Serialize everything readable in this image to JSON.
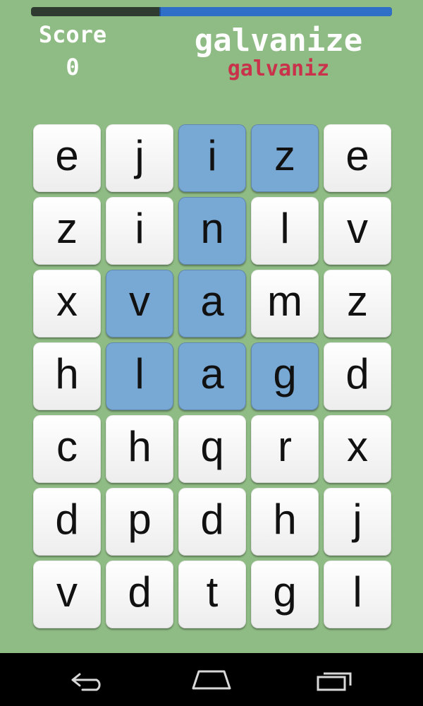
{
  "header": {
    "score_label": "Score",
    "score_value": "0",
    "target_word": "galvanize",
    "current_word": "galvaniz",
    "timer_remaining_fraction": 0.64
  },
  "grid": {
    "rows": [
      [
        {
          "letter": "e",
          "selected": false
        },
        {
          "letter": "j",
          "selected": false
        },
        {
          "letter": "i",
          "selected": true
        },
        {
          "letter": "z",
          "selected": true
        },
        {
          "letter": "e",
          "selected": false
        }
      ],
      [
        {
          "letter": "z",
          "selected": false
        },
        {
          "letter": "i",
          "selected": false
        },
        {
          "letter": "n",
          "selected": true
        },
        {
          "letter": "l",
          "selected": false
        },
        {
          "letter": "v",
          "selected": false
        }
      ],
      [
        {
          "letter": "x",
          "selected": false
        },
        {
          "letter": "v",
          "selected": true
        },
        {
          "letter": "a",
          "selected": true
        },
        {
          "letter": "m",
          "selected": false
        },
        {
          "letter": "z",
          "selected": false
        }
      ],
      [
        {
          "letter": "h",
          "selected": false
        },
        {
          "letter": "l",
          "selected": true
        },
        {
          "letter": "a",
          "selected": true
        },
        {
          "letter": "g",
          "selected": true
        },
        {
          "letter": "d",
          "selected": false
        }
      ],
      [
        {
          "letter": "c",
          "selected": false
        },
        {
          "letter": "h",
          "selected": false
        },
        {
          "letter": "q",
          "selected": false
        },
        {
          "letter": "r",
          "selected": false
        },
        {
          "letter": "x",
          "selected": false
        }
      ],
      [
        {
          "letter": "d",
          "selected": false
        },
        {
          "letter": "p",
          "selected": false
        },
        {
          "letter": "d",
          "selected": false
        },
        {
          "letter": "h",
          "selected": false
        },
        {
          "letter": "j",
          "selected": false
        }
      ],
      [
        {
          "letter": "v",
          "selected": false
        },
        {
          "letter": "d",
          "selected": false
        },
        {
          "letter": "t",
          "selected": false
        },
        {
          "letter": "g",
          "selected": false
        },
        {
          "letter": "l",
          "selected": false
        }
      ]
    ]
  },
  "navbar": {
    "back_icon": "back-icon",
    "home_icon": "home-icon",
    "recents_icon": "recents-icon"
  },
  "colors": {
    "background": "#8fbb84",
    "selected_tile": "#78a8d4",
    "timer_fill": "#2f6fc8",
    "current_word": "#c9324a"
  }
}
